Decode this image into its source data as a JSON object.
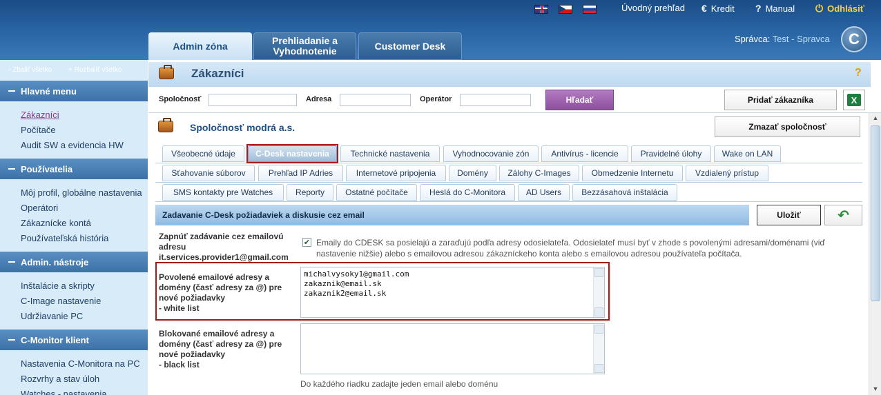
{
  "header": {
    "links": {
      "overview": "Úvodný prehľad",
      "credit": "Kredit",
      "manual": "Manual",
      "logout": "Odhlásiť"
    },
    "tabs": [
      {
        "label": "Admin zóna"
      },
      {
        "label": "Prehliadanie a Vyhodnotenie"
      },
      {
        "label": "Customer Desk"
      }
    ],
    "admin_prefix": "Správca:",
    "admin_user": "Test - Spravca"
  },
  "sidebar": {
    "collapse_all": "- Zbaliť všetko",
    "expand_all": "+ Rozbaliť všetko",
    "sections": [
      {
        "title": "Hlavné menu",
        "items": [
          "Zákazníci",
          "Počítače",
          "Audit SW a evidencia HW"
        ]
      },
      {
        "title": "Používatelia",
        "items": [
          "Môj profil, globálne nastavenia",
          "Operátori",
          "Zákaznícke kontá",
          "Používateľská história"
        ]
      },
      {
        "title": "Admin. nástroje",
        "items": [
          "Inštalácie a skripty",
          "C-Image nastavenie",
          "Udržiavanie PC"
        ]
      },
      {
        "title": "C-Monitor klient",
        "items": [
          "Nastavenia C-Monitora na PC",
          "Rozvrhy a stav úloh",
          "Watches - nastavenia"
        ]
      }
    ]
  },
  "page": {
    "title": "Zákazníci",
    "help": "?",
    "filters": {
      "company": "Spoločnosť",
      "address": "Adresa",
      "operator": "Operátor"
    },
    "search_button": "Hľadať",
    "add_customer_button": "Pridať zákazníka",
    "company_name": "Spoločnosť modrá a.s.",
    "delete_company_button": "Zmazať spoločnosť",
    "tabs_row1": [
      "Všeobecné údaje",
      "C-Desk nastavenia",
      "Technické nastavenia",
      "Vyhodnocovanie zón",
      "Antivírus - licencie",
      "Pravidelné úlohy",
      "Wake on LAN"
    ],
    "tabs_row2": [
      "Sťahovanie súborov",
      "Prehľad IP Adries",
      "Internetové pripojenia",
      "Domény",
      "Zálohy C-Images",
      "Obmedzenie Internetu",
      "Vzdialený prístup"
    ],
    "tabs_row3": [
      "SMS kontakty pre Watches",
      "Reporty",
      "Ostatné počítače",
      "Heslá do C-Monitora",
      "AD Users",
      "Bezzásahová inštalácia"
    ],
    "section_title": "Zadavanie C-Desk požiadaviek a diskusie cez email",
    "save_button": "Uložiť",
    "email_enable_label": "Zapnúť zadávanie cez emailovú adresu it.services.provider1@gmail.com",
    "email_enable_checked": true,
    "email_enable_text": "Emaily do CDESK sa posielajú a zaraďujú podľa adresy odosielateľa. Odosielateľ musí byť v zhode s povolenými adresami/doménami (viď nastavenie nižšie) alebo s emailovou adresou zákazníckeho konta alebo s emailovou adresou používateľa počítača.",
    "whitelist_label_1": "Povolené emailové adresy a domény (časť adresy za @) pre nové požiadavky",
    "whitelist_label_2": "- white list",
    "whitelist_value": "michalvysoky1@gmail.com\nzakaznik@email.sk\nzakaznik2@email.sk",
    "blacklist_label_1": "Blokované emailové adresy a domény (časť adresy za @) pre nové požiadavky",
    "blacklist_label_2": "- black list",
    "blacklist_value": "",
    "hint": "Do každého riadku zadajte jeden email alebo doménu"
  },
  "colors": {
    "header_blue": "#2a66a6",
    "search_purple": "#8c4f9e",
    "highlight_red": "#b01818",
    "sidebar_bg": "#d8ebf8"
  }
}
